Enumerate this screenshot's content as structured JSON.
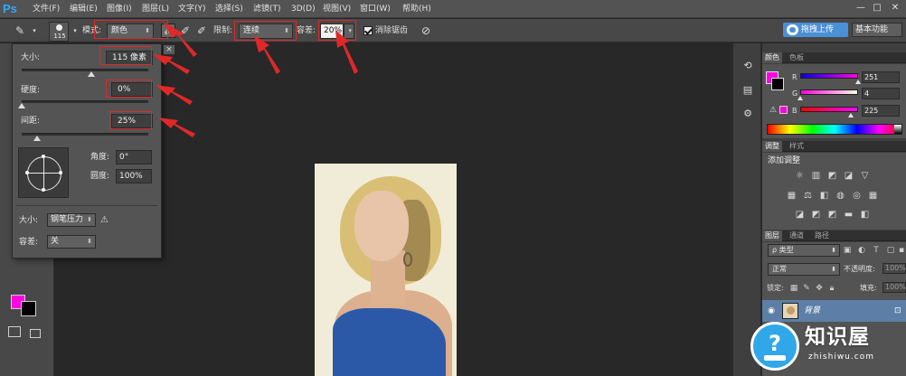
{
  "app": {
    "logo": "Ps",
    "menu": [
      "文件(F)",
      "编辑(E)",
      "图像(I)",
      "图层(L)",
      "文字(Y)",
      "选择(S)",
      "滤镜(T)",
      "3D(D)",
      "视图(V)",
      "窗口(W)",
      "帮助(H)"
    ],
    "window_controls": [
      "—",
      "□",
      "✕"
    ]
  },
  "options_bar": {
    "brush_size": "115",
    "mode_label": "模式:",
    "mode_value": "颜色",
    "limit_label": "限制:",
    "limit_value": "连续",
    "tolerance_label": "容差:",
    "tolerance_value": "20%",
    "antialias_label": "消除锯齿",
    "upload_label": "拖拽上传",
    "workspace_label": "基本功能"
  },
  "brush_panel": {
    "close": "×",
    "size_label": "大小:",
    "size_value": "115 像素",
    "size_position": 0.55,
    "hardness_label": "硬度:",
    "hardness_value": "0%",
    "hardness_position": 0.0,
    "spacing_label": "间距:",
    "spacing_value": "25%",
    "spacing_position": 0.12,
    "angle_label": "角度:",
    "angle_value": "0°",
    "roundness_label": "圆度:",
    "roundness_value": "100%",
    "size_ctrl_label": "大小:",
    "size_ctrl_value": "钢笔压力",
    "tolerance_label": "容差:",
    "tolerance_value": "关"
  },
  "color_panel": {
    "tabs": [
      "颜色",
      "色板"
    ],
    "r_label": "R",
    "r_value": "251",
    "g_label": "G",
    "g_value": "4",
    "b_label": "B",
    "b_value": "225",
    "foreground": "#fb04e1",
    "background": "#000000"
  },
  "adjust_panel": {
    "tabs": [
      "调整",
      "样式"
    ],
    "title": "添加调整"
  },
  "layers_panel": {
    "tabs": [
      "图层",
      "通道",
      "路径"
    ],
    "filter_label": "ρ 类型",
    "blend_mode": "正常",
    "opacity_label": "不透明度:",
    "opacity_value": "100%",
    "lock_label": "锁定:",
    "fill_label": "填充:",
    "fill_value": "100%",
    "layer_name": "背景"
  },
  "watermark": {
    "title": "知识屋",
    "subtitle": "zhishiwu.com"
  },
  "annotation_color": "#e02828"
}
